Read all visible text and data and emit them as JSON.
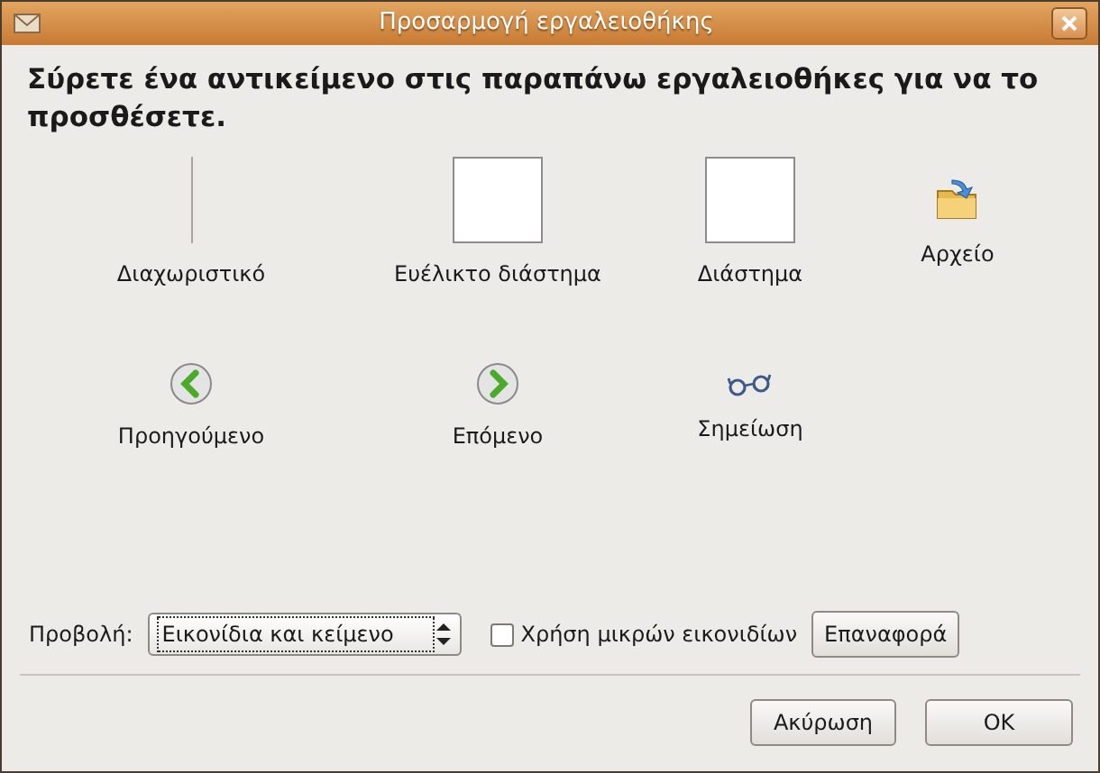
{
  "window": {
    "title": "Προσαρμογή εργαλειοθήκης"
  },
  "instruction": "Σύρετε ένα αντικείμενο στις παραπάνω εργαλειοθήκες για να το προσθέσετε.",
  "items": [
    {
      "kind": "separator",
      "label": "Διαχωριστικό"
    },
    {
      "kind": "space",
      "label": "Ευέλικτο διάστημα"
    },
    {
      "kind": "space",
      "label": "Διάστημα"
    },
    {
      "kind": "folder",
      "label": "Αρχείο"
    },
    {
      "kind": "back",
      "label": "Προηγούμενο"
    },
    {
      "kind": "forward",
      "label": "Επόμενο"
    },
    {
      "kind": "glasses",
      "label": "Σημείωση"
    }
  ],
  "view": {
    "label": "Προβολή:",
    "value": "Εικονίδια και κείμενο"
  },
  "small_icons": {
    "label": "Χρήση μικρών εικονιδίων",
    "checked": false
  },
  "reset_button": "Επαναφορά",
  "buttons": [
    "Ακύρωση",
    "OK"
  ]
}
